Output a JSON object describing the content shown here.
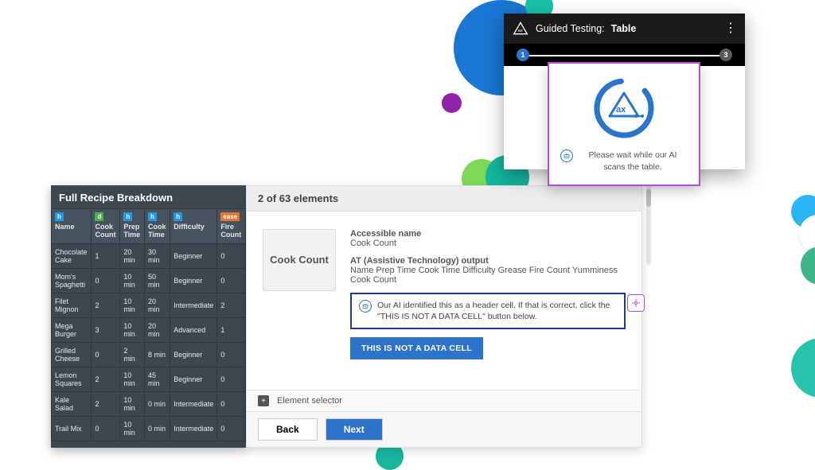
{
  "guided": {
    "label_prefix": "Guided Testing:",
    "label_bold": "Table",
    "step_current": "1",
    "step_last": "3",
    "ai_modal_msg": "Please wait while our AI scans the table."
  },
  "recipe": {
    "title": "Full Recipe Breakdown",
    "headers": {
      "name": "Name",
      "cook_count": "Cook Count",
      "prep_time": "Prep Time",
      "cook_time": "Cook Time",
      "difficulty": "Difficulty",
      "fire_badge": "ease",
      "fire_count": "Fire Count"
    },
    "rows": [
      {
        "name": "Chocolate Cake",
        "cook_count": "1",
        "prep": "20 min",
        "cook": "30 min",
        "diff": "Beginner",
        "fire": "0"
      },
      {
        "name": "Mom's Spaghetti",
        "cook_count": "0",
        "prep": "10 min",
        "cook": "50 min",
        "diff": "Beginner",
        "fire": "0"
      },
      {
        "name": "Filet Mignon",
        "cook_count": "2",
        "prep": "10 min",
        "cook": "20 min",
        "diff": "Intermediate",
        "fire": "2"
      },
      {
        "name": "Mega Burger",
        "cook_count": "3",
        "prep": "10 min",
        "cook": "20 min",
        "diff": "Advanced",
        "fire": "1"
      },
      {
        "name": "Grilled Cheese",
        "cook_count": "0",
        "prep": "2 min",
        "cook": "8 min",
        "diff": "Beginner",
        "fire": "0"
      },
      {
        "name": "Lemon Squares",
        "cook_count": "2",
        "prep": "10 min",
        "cook": "45 min",
        "diff": "Beginner",
        "fire": "0"
      },
      {
        "name": "Kale Salad",
        "cook_count": "2",
        "prep": "10 min",
        "cook": "0 min",
        "diff": "Intermediate",
        "fire": "0"
      },
      {
        "name": "Trail Mix",
        "cook_count": "0",
        "prep": "10 min",
        "cook": "0 min",
        "diff": "Intermediate",
        "fire": "0"
      }
    ],
    "badge_h": "h",
    "badge_d": "d"
  },
  "details": {
    "counter": "2 of 63 elements",
    "cell_preview": "Cook Count",
    "accessible_name_label": "Accessible name",
    "accessible_name_value": "Cook Count",
    "at_output_label": "AT (Assistive Technology) output",
    "at_output_value": "Name Prep Time Cook Time Difficulty Grease Fire Count Yumminess Cook Count",
    "ai_message": "Our AI identified this as a header cell. If that is correct, click the \"THIS IS NOT A DATA CELL\" button below.",
    "not_data_btn": "THIS IS NOT A DATA CELL",
    "element_selector_label": "Element selector",
    "back_btn": "Back",
    "next_btn": "Next"
  }
}
